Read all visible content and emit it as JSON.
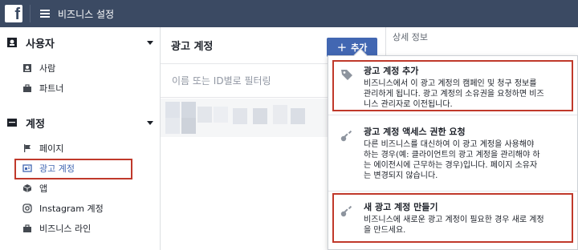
{
  "topbar": {
    "logo": "f",
    "title": "비즈니스 설정"
  },
  "sidebar": {
    "sections": [
      {
        "label": "사용자",
        "icon": "users-icon",
        "items": [
          {
            "label": "사람",
            "icon": "person-icon"
          },
          {
            "label": "파트너",
            "icon": "briefcase-icon"
          }
        ]
      },
      {
        "label": "계정",
        "icon": "folder-icon",
        "items": [
          {
            "label": "페이지",
            "icon": "flag-icon"
          },
          {
            "label": "광고 계정",
            "icon": "ad-account-icon"
          },
          {
            "label": "앱",
            "icon": "cube-icon"
          },
          {
            "label": "Instagram 계정",
            "icon": "instagram-icon"
          },
          {
            "label": "비즈니스 라인",
            "icon": "briefcase-icon"
          }
        ]
      }
    ]
  },
  "main": {
    "title": "광고 계정",
    "add_label": "추가",
    "filter_placeholder": "이름 또는 ID별로 필터링"
  },
  "details": {
    "title": "상세 정보"
  },
  "dropdown": {
    "options": [
      {
        "title": "광고 계정 추가",
        "desc": [
          "비즈니스에서 이 광고 계정의 캠페인 및 청구 정보를",
          "관리하게 됩니다. 광고 계정의 소유권을 요청하면 비즈",
          "니스 관리자로 이전됩니다."
        ]
      },
      {
        "title": "광고 계정 액세스 권한 요청",
        "desc": [
          "다른 비즈니스를 대신하여 이 광고 계정을 사용해야",
          "하는 경우(예: 클라이언트의 광고 계정을 관리해야 하",
          "는 에이전시에 근무하는 경우)입니다. 페이지 소유자",
          "는 변경되지 않습니다."
        ]
      },
      {
        "title": "새 광고 계정 만들기",
        "desc": [
          "비즈니스에 새로운 광고 계정이 필요한 경우 새로 계정",
          "을 만드세요."
        ]
      }
    ]
  },
  "colors": {
    "topbar": "#3b4a63",
    "accent": "#4267b2",
    "highlight": "#c0392b"
  }
}
